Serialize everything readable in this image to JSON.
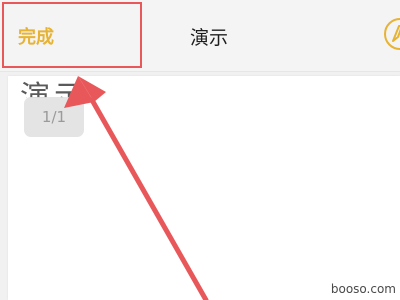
{
  "toolbar": {
    "done_label": "完成",
    "title": "演示",
    "accent_color": "#e7b334"
  },
  "slide": {
    "text": "演示",
    "page_indicator": "1/1"
  },
  "annotation": {
    "color": "#e8585a"
  },
  "watermark": {
    "text": "booso.com"
  }
}
